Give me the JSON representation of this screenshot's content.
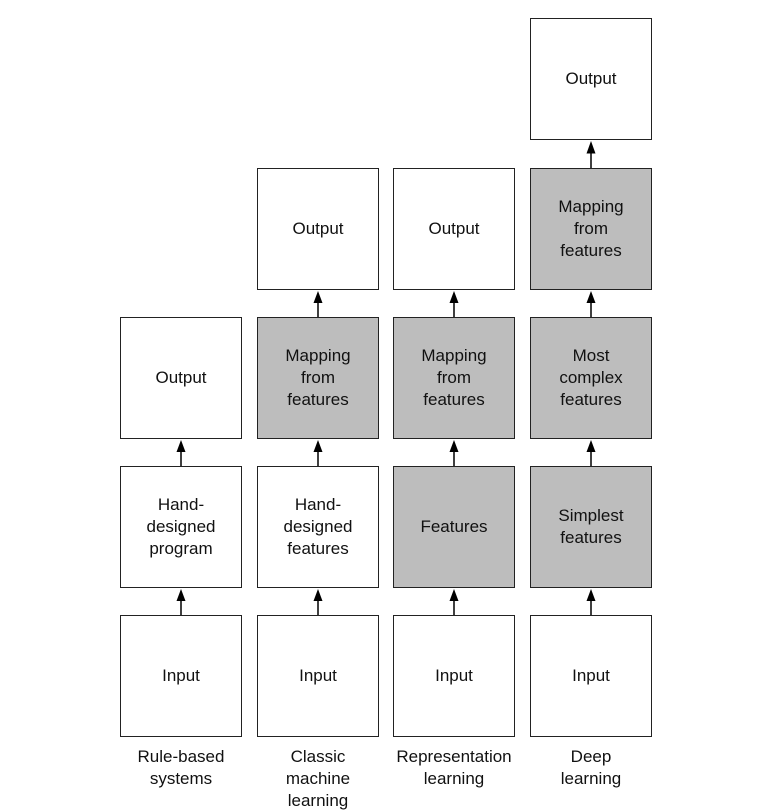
{
  "columns": [
    {
      "label": "Rule-based\nsystems",
      "boxes": [
        {
          "text": "Input",
          "shaded": false
        },
        {
          "text": "Hand-\ndesigned\nprogram",
          "shaded": false
        },
        {
          "text": "Output",
          "shaded": false
        }
      ]
    },
    {
      "label": "Classic\nmachine\nlearning",
      "boxes": [
        {
          "text": "Input",
          "shaded": false
        },
        {
          "text": "Hand-\ndesigned\nfeatures",
          "shaded": false
        },
        {
          "text": "Mapping\nfrom\nfeatures",
          "shaded": true
        },
        {
          "text": "Output",
          "shaded": false
        }
      ]
    },
    {
      "label": "Representation\nlearning",
      "boxes": [
        {
          "text": "Input",
          "shaded": false
        },
        {
          "text": "Features",
          "shaded": true
        },
        {
          "text": "Mapping\nfrom\nfeatures",
          "shaded": true
        },
        {
          "text": "Output",
          "shaded": false
        }
      ]
    },
    {
      "label": "Deep\nlearning",
      "boxes": [
        {
          "text": "Input",
          "shaded": false
        },
        {
          "text": "Simplest\nfeatures",
          "shaded": true
        },
        {
          "text": "Most\ncomplex\nfeatures",
          "shaded": true
        },
        {
          "text": "Mapping\nfrom\nfeatures",
          "shaded": true
        },
        {
          "text": "Output",
          "shaded": false
        }
      ]
    }
  ],
  "colors": {
    "shaded": "#bdbdbd",
    "plain": "#ffffff",
    "stroke": "#222222"
  }
}
